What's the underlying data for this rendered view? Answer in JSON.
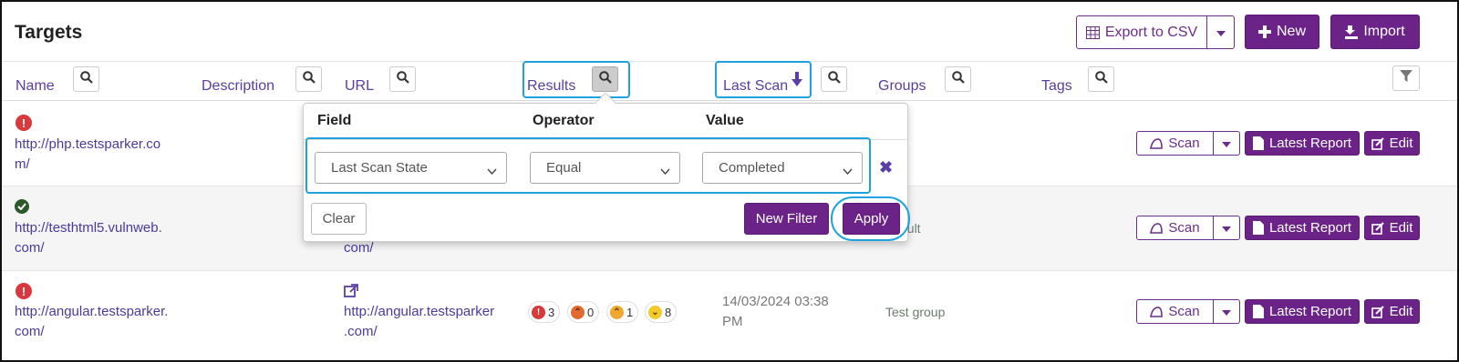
{
  "header": {
    "title": "Targets",
    "export_label": "Export to CSV",
    "new_label": "New",
    "import_label": "Import"
  },
  "columns": {
    "name": "Name",
    "description": "Description",
    "url": "URL",
    "results": "Results",
    "last_scan": "Last Scan",
    "groups": "Groups",
    "tags": "Tags"
  },
  "rows": [
    {
      "status": "error",
      "name": "http://php.testsparker.com/",
      "name_lines": [
        "http://php.testsparker.co",
        "m/"
      ],
      "actions": {
        "scan": "Scan",
        "report": "Latest Report",
        "edit": "Edit"
      }
    },
    {
      "status": "ok",
      "name_lines": [
        "http://testhtml5.vulnweb.",
        "com/"
      ],
      "url_tail": "com/",
      "group_tail": "ault",
      "actions": {
        "scan": "Scan",
        "report": "Latest Report",
        "edit": "Edit"
      }
    },
    {
      "status": "error",
      "name_lines": [
        "http://angular.testsparker.",
        "com/"
      ],
      "url_lines": [
        "http://angular.testsparker",
        ".com/"
      ],
      "results": {
        "critical": "3",
        "high": "0",
        "medium": "1",
        "low": "8"
      },
      "last_scan_lines": [
        "14/03/2024 03:38",
        "PM"
      ],
      "group": "Test group",
      "actions": {
        "scan": "Scan",
        "report": "Latest Report",
        "edit": "Edit"
      }
    }
  ],
  "filter_popup": {
    "field_header": "Field",
    "operator_header": "Operator",
    "value_header": "Value",
    "field_value": "Last Scan State",
    "operator_value": "Equal",
    "value_value": "Completed",
    "clear_label": "Clear",
    "new_filter_label": "New Filter",
    "apply_label": "Apply"
  },
  "colors": {
    "brand": "#6b2387",
    "link": "#4b3a9e",
    "highlight": "#1fa3e0",
    "error": "#d9393a",
    "ok": "#2a5a2a"
  },
  "icons": [
    "table-icon",
    "plus-icon",
    "import-icon",
    "search-icon",
    "arrow-down-icon",
    "funnel-icon",
    "exclamation-icon",
    "check-icon",
    "external-link-icon",
    "scan-icon",
    "document-icon",
    "edit-icon",
    "caret-down-icon",
    "close-icon",
    "chevron-down-icon"
  ]
}
